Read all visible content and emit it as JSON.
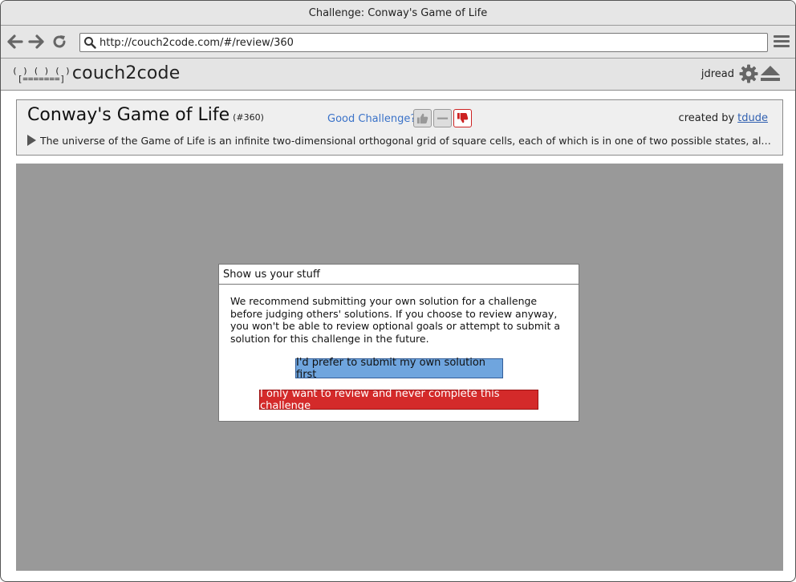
{
  "window": {
    "title": "Challenge: Conway's Game of Life"
  },
  "browser": {
    "url": "http://couch2code.com/#/review/360"
  },
  "app": {
    "logo_mark_top": "( ) ( ) ( )",
    "logo_mark_bottom": "[=======]",
    "logo_text": "couch2code",
    "username": "jdread"
  },
  "challenge": {
    "title": "Conway's Game of Life",
    "id": "(#360)",
    "good_challenge_label": "Good Challenge?",
    "created_by_label": "created by",
    "author": "tdude",
    "description": "The universe of the Game of Life is an infinite two-dimensional orthogonal grid of square cells, each of which is in one of two possible states, alive or dead..."
  },
  "modal": {
    "title": "Show us your stuff",
    "message": "We recommend submitting your own solution for a challenge before judging others' solutions. If you choose to review anyway, you won't be able to review optional goals or attempt to submit a solution for this challenge in the future.",
    "primary_button": "I'd prefer to submit my own solution first",
    "danger_button": "I only want to review and never complete this challenge"
  },
  "colors": {
    "overlay": "#999999",
    "primary": "#6fa5de",
    "danger": "#d42a2a",
    "link": "#3a72c8"
  }
}
